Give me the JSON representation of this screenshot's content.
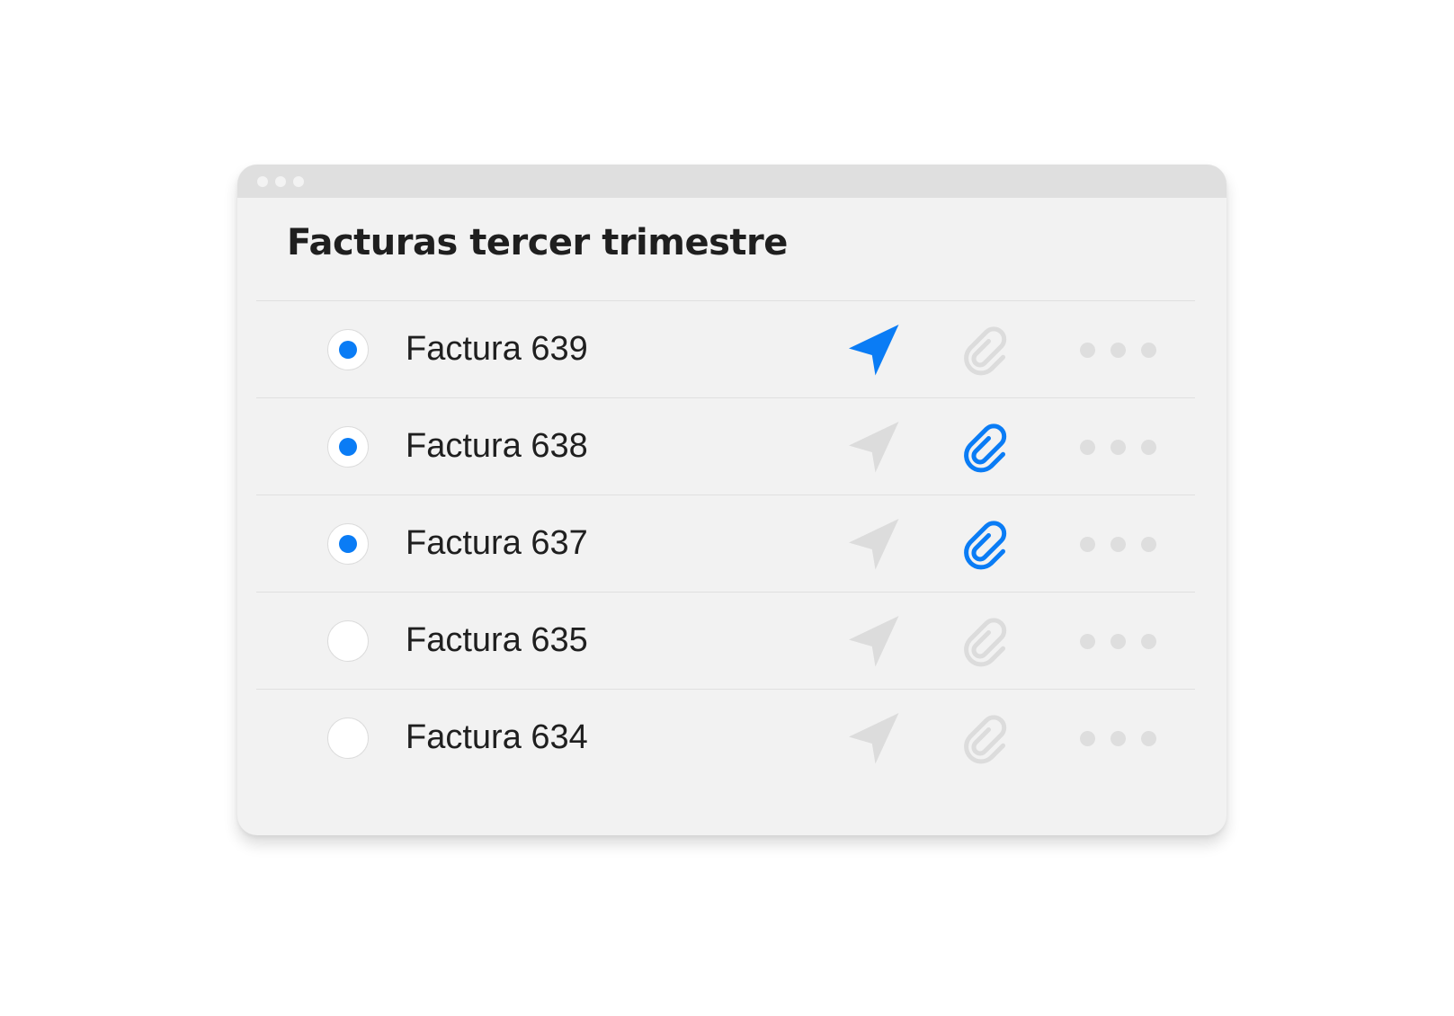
{
  "window": {
    "title": "Facturas tercer trimestre"
  },
  "colors": {
    "accent": "#0a7cf5",
    "inactive_icon": "#dcdcdc",
    "panel_bg": "#f2f2f2",
    "titlebar_bg": "#dfdfdf"
  },
  "rows": [
    {
      "label": "Factura 639",
      "selected": true,
      "sent": true,
      "attachment": false,
      "icons": [
        "send-icon",
        "paperclip-icon",
        "more-icon"
      ]
    },
    {
      "label": "Factura 638",
      "selected": true,
      "sent": false,
      "attachment": true,
      "icons": [
        "send-icon",
        "paperclip-icon",
        "more-icon"
      ]
    },
    {
      "label": "Factura 637",
      "selected": true,
      "sent": false,
      "attachment": true,
      "icons": [
        "send-icon",
        "paperclip-icon",
        "more-icon"
      ]
    },
    {
      "label": "Factura 635",
      "selected": false,
      "sent": false,
      "attachment": false,
      "icons": [
        "send-icon",
        "paperclip-icon",
        "more-icon"
      ]
    },
    {
      "label": "Factura 634",
      "selected": false,
      "sent": false,
      "attachment": false,
      "icons": [
        "send-icon",
        "paperclip-icon",
        "more-icon"
      ]
    }
  ]
}
